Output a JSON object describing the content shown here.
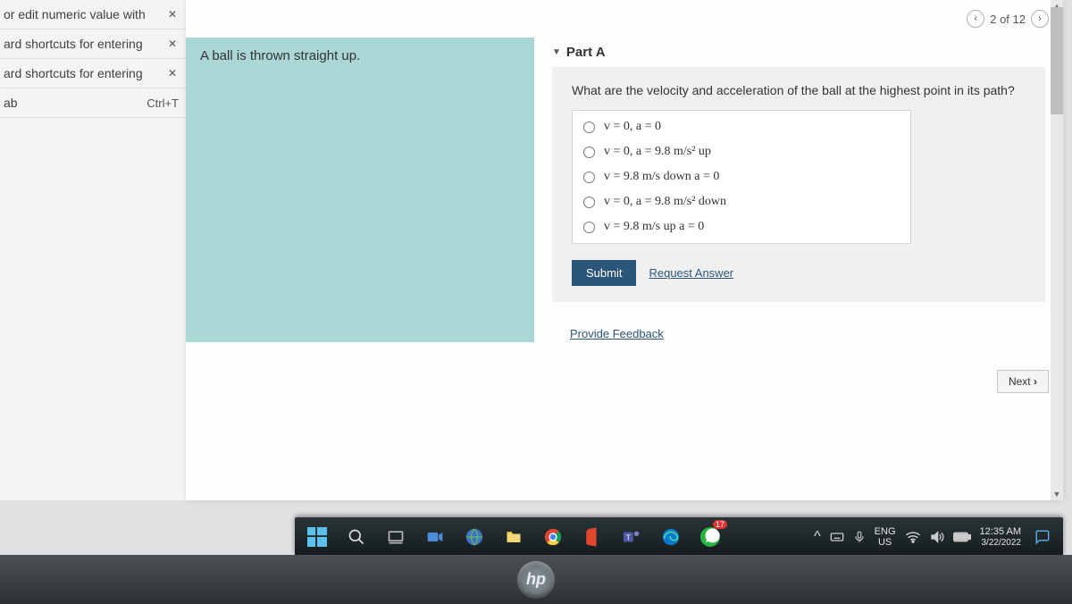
{
  "sidebar": {
    "items": [
      {
        "label": "or edit numeric value with",
        "close": true
      },
      {
        "label": "ard shortcuts for entering",
        "close": true
      },
      {
        "label": "ard shortcuts for entering",
        "close": true
      },
      {
        "label": "ab",
        "key": "Ctrl+T"
      }
    ]
  },
  "pager": {
    "prev_glyph": "‹",
    "next_glyph": "›",
    "label": "2 of 12"
  },
  "problem": {
    "title": "A ball is thrown straight up."
  },
  "part": {
    "title": "Part A",
    "question": "What are the velocity and acceleration of the ball at the highest point in its path?",
    "options": [
      "v = 0, a = 0",
      "v = 0, a = 9.8 m/s² up",
      "v = 9.8 m/s down a = 0",
      "v = 0, a = 9.8 m/s² down",
      "v = 9.8 m/s up a = 0"
    ],
    "submit_label": "Submit",
    "request_label": "Request Answer"
  },
  "feedback_label": "Provide Feedback",
  "next_label": "Next",
  "taskbar": {
    "tray_up": "^",
    "lang1": "ENG",
    "lang2": "US",
    "time": "12:35 AM",
    "date": "3/22/2022",
    "badge": "17"
  },
  "brand": "hp"
}
